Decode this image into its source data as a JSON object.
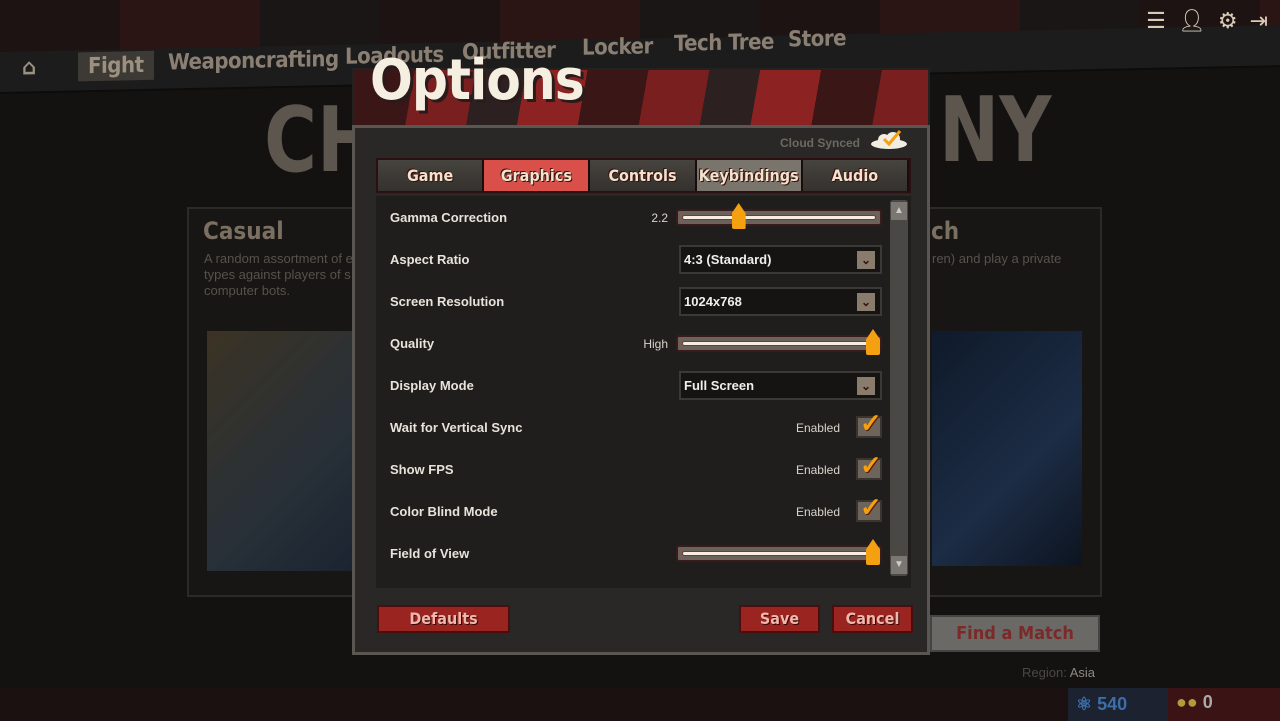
{
  "nav": {
    "items": [
      "Fight",
      "Weaponcrafting",
      "Loadouts",
      "Outfitter",
      "Locker",
      "Tech Tree",
      "Store"
    ],
    "active": "Fight"
  },
  "top_icons": [
    "leaderboard-icon",
    "profile-icon",
    "gear-icon",
    "exit-icon"
  ],
  "background": {
    "big_title_left": "CH",
    "big_title_right": "NY",
    "casual_title": "Casual",
    "casual_desc": "A random assortment of e types against players of s computer bots.",
    "right_title": "ch",
    "right_desc": "ren) and play a private",
    "find_match": "Find a Match",
    "region_label": "Region:",
    "region_value": "Asia",
    "currency_blue": "540",
    "currency_gold": "0"
  },
  "modal": {
    "title": "Options",
    "cloud_status": "Cloud Synced",
    "tabs": [
      "Game",
      "Graphics",
      "Controls",
      "Keybindings",
      "Audio"
    ],
    "active_tab": "Graphics",
    "settings": [
      {
        "label": "Gamma Correction",
        "type": "slider",
        "value_text": "2.2",
        "fraction": 0.27
      },
      {
        "label": "Aspect Ratio",
        "type": "select",
        "value": "4:3 (Standard)"
      },
      {
        "label": "Screen Resolution",
        "type": "select",
        "value": "1024x768"
      },
      {
        "label": "Quality",
        "type": "slider",
        "value_text": "High",
        "fraction": 1.0
      },
      {
        "label": "Display Mode",
        "type": "select",
        "value": "Full Screen"
      },
      {
        "label": "Wait for Vertical Sync",
        "type": "check",
        "value_text": "Enabled",
        "checked": true
      },
      {
        "label": "Show FPS",
        "type": "check",
        "value_text": "Enabled",
        "checked": true
      },
      {
        "label": "Color Blind Mode",
        "type": "check",
        "value_text": "Enabled",
        "checked": true
      },
      {
        "label": "Field of View",
        "type": "slider",
        "value_text": "",
        "fraction": 1.0
      }
    ],
    "buttons": {
      "defaults": "Defaults",
      "save": "Save",
      "cancel": "Cancel"
    }
  },
  "colors": {
    "accent": "#d9504b",
    "thumb": "#f4a010",
    "button": "#9a2420"
  }
}
